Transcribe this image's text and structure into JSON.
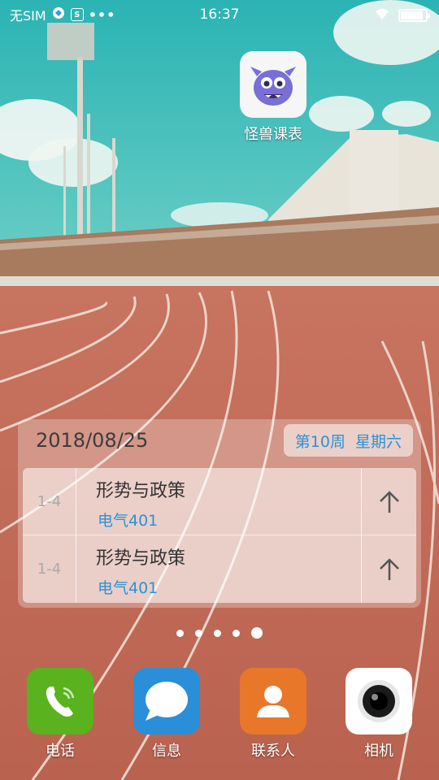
{
  "statusbar": {
    "carrier": "无SIM",
    "icon_box_label": "S",
    "more": "•••",
    "time": "16:37",
    "battery_level": 0.9
  },
  "home": {
    "top_app": {
      "label": "怪兽课表",
      "icon": "monster-app-icon"
    }
  },
  "widget": {
    "date": "2018/08/25",
    "week": "第10周",
    "weekday": "星期六",
    "courses": [
      {
        "period": "1-4",
        "name": "形势与政策",
        "room": "电气401"
      },
      {
        "period": "1-4",
        "name": "形势与政策",
        "room": "电气401"
      }
    ]
  },
  "pager": {
    "pages": 5,
    "current": 5
  },
  "dock": [
    {
      "label": "电话",
      "icon": "phone-icon",
      "color": "#5ab21e"
    },
    {
      "label": "信息",
      "icon": "message-icon",
      "color": "#2a8fd8"
    },
    {
      "label": "联系人",
      "icon": "contacts-icon",
      "color": "#e8772a"
    },
    {
      "label": "相机",
      "icon": "camera-icon",
      "color": "#ffffff"
    }
  ],
  "colors": {
    "accent_blue": "#2a93d5",
    "sky": "#34b7b2",
    "track": "#c56a57"
  }
}
